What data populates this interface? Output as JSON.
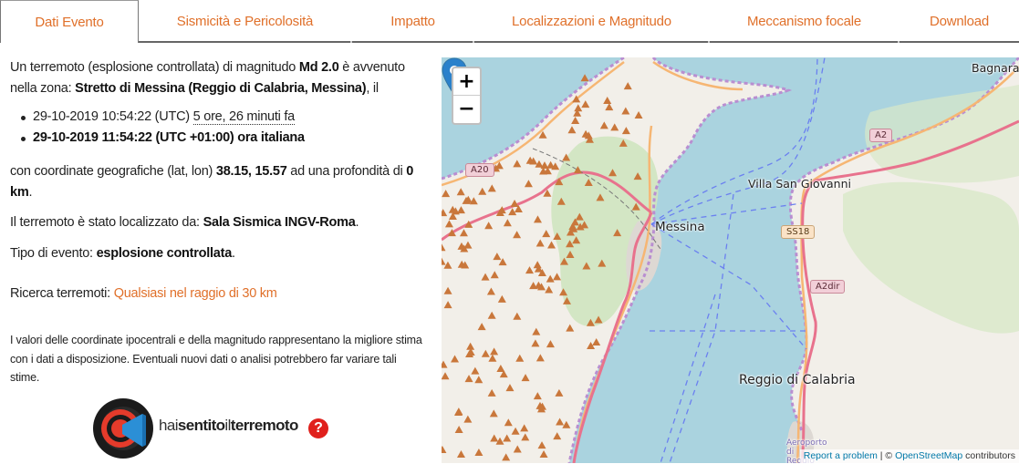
{
  "tabs": [
    {
      "label": "Dati Evento",
      "active": true
    },
    {
      "label": "Sismicità e Pericolosità",
      "active": false
    },
    {
      "label": "Impatto",
      "active": false
    },
    {
      "label": "Localizzazioni e Magnitudo",
      "active": false
    },
    {
      "label": "Meccanismo focale",
      "active": false
    },
    {
      "label": "Download",
      "active": false
    }
  ],
  "event": {
    "intro_prefix": "Un terremoto (esplosione controllata) di magnitudo ",
    "magnitude": "Md 2.0",
    "intro_mid": " è avvenuto nella zona: ",
    "zone": "Stretto di Messina (Reggio di Calabria, Messina)",
    "intro_suffix": ", il",
    "time_utc": "29-10-2019 10:54:22 (UTC) ",
    "time_ago": "5 ore, 26 minuti fa",
    "time_local": "29-10-2019 11:54:22 (UTC +01:00) ora italiana",
    "coords_prefix": "con coordinate geografiche (lat, lon) ",
    "coords": "38.15, 15.57",
    "coords_mid": " ad una profondità di ",
    "depth": "0 km",
    "coords_suffix": ".",
    "located_prefix": "Il terremoto è stato localizzato da: ",
    "located_by": "Sala Sismica INGV-Roma",
    "located_suffix": ".",
    "type_prefix": "Tipo di evento: ",
    "type": "esplosione controllata",
    "type_suffix": ".",
    "search_prefix": "Ricerca terremoti: ",
    "search_link": "Qualsiasi nel raggio di 30 km",
    "note": "I valori delle coordinate ipocentrali e della magnitudo rappresentano la migliore stima con i dati a disposizione. Eventuali nuovi dati o analisi potrebbero far variare tali stime."
  },
  "logo": {
    "text_thin1": "hai",
    "text_bold1": "sentito",
    "text_thin2": "il",
    "text_bold2": "terremoto",
    "question": "?"
  },
  "map": {
    "zoom_in": "+",
    "zoom_out": "−",
    "labels": {
      "bagnara": "Bagnara",
      "villa": "Villa San Giovanni",
      "messina": "Messina",
      "reggio": "Reggio di Calabria",
      "aeroporto": "Aeroporto di Reggio"
    },
    "shields": {
      "a20": "A20",
      "a2": "A2",
      "ss18": "SS18",
      "a2dir": "A2dir"
    },
    "attribution": {
      "report": "Report a problem",
      "sep": " | © ",
      "osm": "OpenStreetMap",
      "contributors": " contributors"
    },
    "colors": {
      "sea": "#aad3df",
      "land": "#f2efe9",
      "forest": "#cfe4c0",
      "motorway": "#e8728d",
      "trunk": "#f6b673",
      "peak": "#c9773b",
      "ferry": "#6b80f0",
      "border": "#b98ed1",
      "marker": "#2a81cb"
    }
  }
}
